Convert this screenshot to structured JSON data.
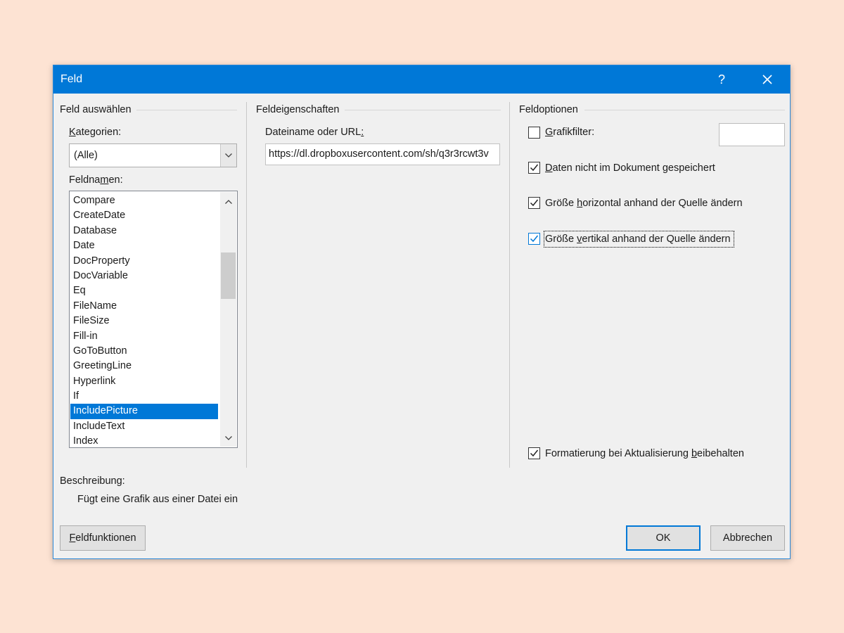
{
  "dialog": {
    "title": "Feld",
    "help_label": "?"
  },
  "select_field": {
    "section_title": "Feld auswählen",
    "categories_label_accel": "K",
    "categories_label_rest": "ategorien:",
    "categories_value": "(Alle)",
    "field_names_label_pre": "Feldna",
    "field_names_label_accel": "m",
    "field_names_label_post": "en:",
    "field_names": [
      "Compare",
      "CreateDate",
      "Database",
      "Date",
      "DocProperty",
      "DocVariable",
      "Eq",
      "FileName",
      "FileSize",
      "Fill-in",
      "GoToButton",
      "GreetingLine",
      "Hyperlink",
      "If",
      "IncludePicture",
      "IncludeText",
      "Index"
    ],
    "selected_field": "IncludePicture"
  },
  "field_properties": {
    "section_title": "Feldeigenschaften",
    "url_label_pre": "Dateiname oder URL",
    "url_label_accel": ":",
    "url_value": "https://dl.dropboxusercontent.com/sh/q3r3rcwt3v"
  },
  "field_options": {
    "section_title": "Feldoptionen",
    "graphic_filter": {
      "accel": "G",
      "rest": "rafikfilter:",
      "checked": false
    },
    "option_data": {
      "accel": "D",
      "rest": "aten nicht im Dokument gespeichert",
      "checked": true
    },
    "option_horizontal": {
      "pre": "Größe ",
      "accel": "h",
      "rest": "orizontal anhand der Quelle ändern",
      "checked": true
    },
    "option_vertical": {
      "pre": "Größe ",
      "accel": "v",
      "rest": "ertikal anhand der Quelle ändern",
      "checked": true
    },
    "option_format": {
      "pre": "Formatierung bei Aktualisierung ",
      "accel": "b",
      "rest": "eibehalten",
      "checked": true
    }
  },
  "description": {
    "label": "Beschreibung:",
    "text": "Fügt eine Grafik aus einer Datei ein"
  },
  "buttons": {
    "field_codes_accel": "F",
    "field_codes_rest": "eldfunktionen",
    "ok": "OK",
    "cancel": "Abbrechen"
  },
  "colors": {
    "accent": "#0078d7",
    "background": "#fde3d3",
    "dialog_bg": "#f0f0f0"
  }
}
